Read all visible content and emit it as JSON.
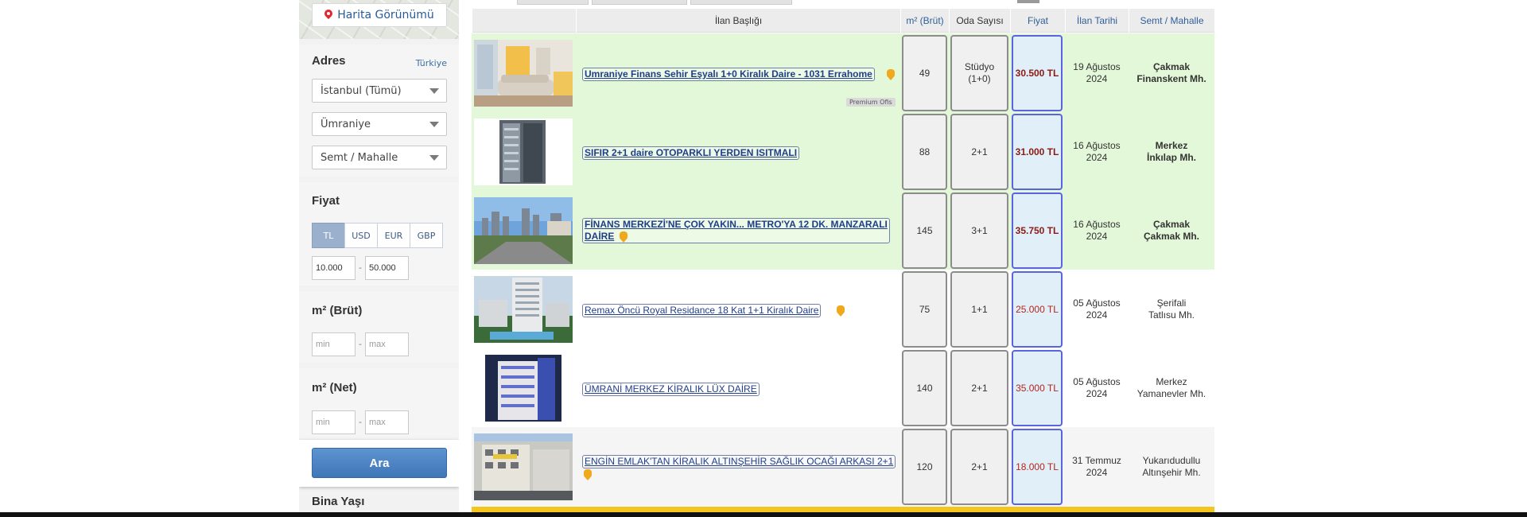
{
  "sidebar": {
    "map_button": "Harita Görünümü",
    "address": {
      "title": "Adres",
      "country_link": "Türkiye",
      "province": "İstanbul (Tümü)",
      "district": "Ümraniye",
      "neighborhood": "Semt / Mahalle"
    },
    "price": {
      "title": "Fiyat",
      "currencies": [
        "TL",
        "USD",
        "EUR",
        "GBP"
      ],
      "active_currency": "TL",
      "min_value": "10.000",
      "max_value": "50.000",
      "separator": "-"
    },
    "m2_gross": {
      "title": "m² (Brüt)",
      "min_placeholder": "min",
      "max_placeholder": "max"
    },
    "m2_net": {
      "title": "m² (Net)",
      "min_placeholder": "min",
      "max_placeholder": "max"
    },
    "search_button": "Ara",
    "building_age_title": "Bina Yaşı"
  },
  "table": {
    "headers": {
      "title": "İlan Başlığı",
      "m2": "m² (Brüt)",
      "rooms": "Oda Sayısı",
      "price": "Fiyat",
      "date": "İlan Tarihi",
      "location": "Semt / Mahalle"
    },
    "premium_label": "Premium Ofis",
    "rows": [
      {
        "title": "Umraniye Finans Sehir Eşyalı 1+0 Kiralık Daire - 1031 Errahome",
        "m2": "49",
        "rooms_line1": "Stüdyo",
        "rooms_line2": "(1+0)",
        "price": "30.500 TL",
        "date_line1": "19 Ağustos",
        "date_line2": "2024",
        "loc_line1": "Çakmak",
        "loc_line2": "Finanskent Mh."
      },
      {
        "title": "SIFIR 2+1 daire OTOPARKLI YERDEN ISITMALI",
        "m2": "88",
        "rooms_line1": "2+1",
        "rooms_line2": "",
        "price": "31.000 TL",
        "date_line1": "16 Ağustos",
        "date_line2": "2024",
        "loc_line1": "Merkez",
        "loc_line2": "İnkılap Mh."
      },
      {
        "title_line1": "FİNANS MERKEZİ'NE ÇOK YAKIN... METRO'YA 12 DK. MANZARALI",
        "title_line2": "DAİRE",
        "m2": "145",
        "rooms_line1": "3+1",
        "rooms_line2": "",
        "price": "35.750 TL",
        "date_line1": "16 Ağustos",
        "date_line2": "2024",
        "loc_line1": "Çakmak",
        "loc_line2": "Çakmak Mh."
      },
      {
        "title": "Remax Öncü Royal Residance 18 Kat 1+1 Kiralık Daire",
        "m2": "75",
        "rooms_line1": "1+1",
        "rooms_line2": "",
        "price": "25.000 TL",
        "date_line1": "05 Ağustos",
        "date_line2": "2024",
        "loc_line1": "Şerifali",
        "loc_line2": "Tatlısu Mh."
      },
      {
        "title": "ÜMRANİ MERKEZ KİRALIK LÜX DAİRE",
        "m2": "140",
        "rooms_line1": "2+1",
        "rooms_line2": "",
        "price": "35.000 TL",
        "date_line1": "05 Ağustos",
        "date_line2": "2024",
        "loc_line1": "Merkez",
        "loc_line2": "Yamanevler Mh."
      },
      {
        "title": "ENGİN EMLAK'TAN KİRALIK ALTINŞEHİR SAĞLIK OCAĞI ARKASI 2+1",
        "m2": "120",
        "rooms_line1": "2+1",
        "rooms_line2": "",
        "price": "18.000 TL",
        "date_line1": "31 Temmuz",
        "date_line2": "2024",
        "loc_line1": "Yukarıdudullu",
        "loc_line2": "Altınşehir Mh."
      }
    ]
  },
  "colors": {
    "highlight_row": "#e3f8d8",
    "link": "#203e8a",
    "price": "#b8241c",
    "accent_button": "#3f76b8",
    "bottom_bar": "#f5c51f"
  }
}
